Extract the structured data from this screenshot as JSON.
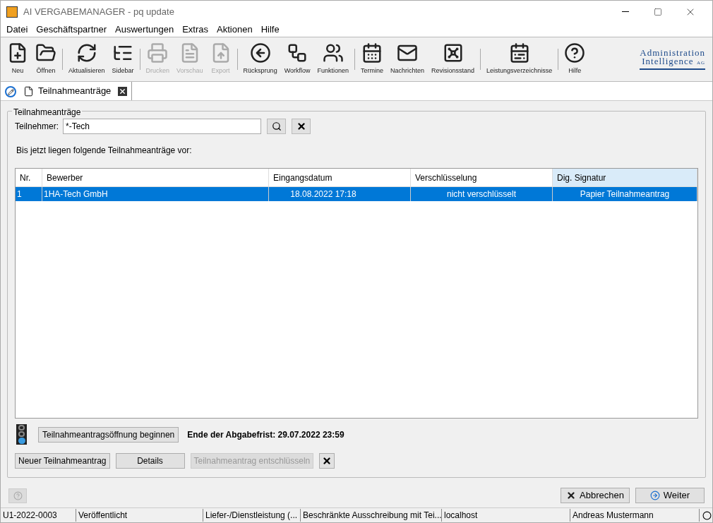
{
  "window": {
    "title": "AI VERGABEMANAGER - pq update"
  },
  "menu": [
    "Datei",
    "Geschäftspartner",
    "Auswertungen",
    "Extras",
    "Aktionen",
    "Hilfe"
  ],
  "toolbar": [
    [
      {
        "label": "Neu",
        "disabled": false
      },
      {
        "label": "Öffnen",
        "disabled": false
      }
    ],
    [
      {
        "label": "Aktualisieren",
        "disabled": false
      },
      {
        "label": "Sidebar",
        "disabled": false
      }
    ],
    [
      {
        "label": "Drucken",
        "disabled": true
      },
      {
        "label": "Vorschau",
        "disabled": true
      },
      {
        "label": "Export",
        "disabled": true
      }
    ],
    [
      {
        "label": "Rücksprung",
        "disabled": false
      },
      {
        "label": "Workflow",
        "disabled": false
      },
      {
        "label": "Funktionen",
        "disabled": false
      }
    ],
    [
      {
        "label": "Termine",
        "disabled": false
      },
      {
        "label": "Nachrichten",
        "disabled": false
      },
      {
        "label": "Revisionsstand",
        "disabled": false
      }
    ],
    [
      {
        "label": "Leistungsverzeichnisse",
        "disabled": false
      }
    ],
    [
      {
        "label": "Hilfe",
        "disabled": false
      }
    ]
  ],
  "logo": {
    "line1": "Administration",
    "line2": "Intelligence",
    "suffix": "AG"
  },
  "tabs": [
    {
      "label": "Teilnahmeanträge",
      "selected": true
    }
  ],
  "group": {
    "title": "Teilnahmeanträge",
    "filter_label": "Teilnehmer:",
    "filter_value": "*-Tech",
    "info": "Bis jetzt liegen folgende Teilnahmeanträge vor:"
  },
  "table": {
    "columns": [
      {
        "label": "Nr.",
        "highlighted": false
      },
      {
        "label": "Bewerber",
        "highlighted": false
      },
      {
        "label": "Eingangsdatum",
        "highlighted": false
      },
      {
        "label": "Verschlüsselung",
        "highlighted": false
      },
      {
        "label": "Dig. Signatur",
        "highlighted": true
      }
    ],
    "rows": [
      {
        "cells": [
          "1",
          "1HA-Tech GmbH",
          "18.08.2022 17:18",
          "nicht verschlüsselt",
          "Papier Teilnahmeantrag"
        ],
        "selected": true
      }
    ]
  },
  "opening": {
    "button": "Teilnahmeantragsöffnung beginnen",
    "deadline": "Ende der Abgabefrist: 29.07.2022 23:59"
  },
  "actions": [
    {
      "label": "Neuer Teilnahmeantrag",
      "disabled": false
    },
    {
      "label": "Details",
      "disabled": false
    },
    {
      "label": "Teilnahmeantrag entschlüsseln",
      "disabled": true
    }
  ],
  "footer_buttons": [
    {
      "label": "Abbrechen",
      "kind": "cancel"
    },
    {
      "label": "Weiter",
      "kind": "next"
    }
  ],
  "status_bar": [
    "U1-2022-0003",
    "Veröffentlicht",
    "Liefer-/Dienstleistung (...",
    "Beschränkte Ausschreibung mit Tei...",
    "localhost",
    "Andreas Mustermann"
  ]
}
